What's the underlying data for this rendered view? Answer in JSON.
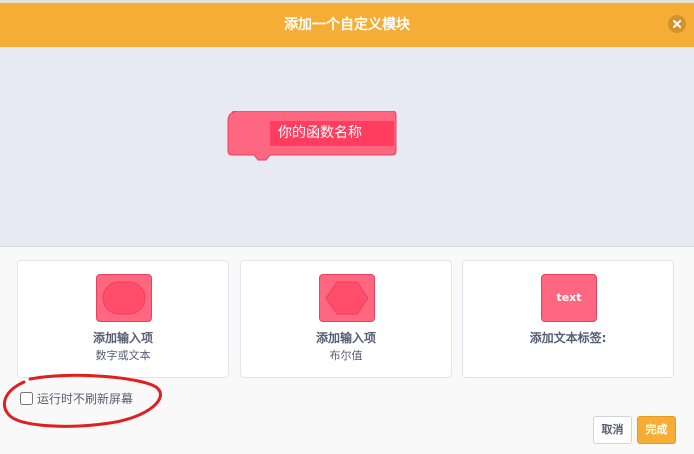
{
  "dialog": {
    "title": "添加一个自定义模块",
    "close_icon": "close-icon"
  },
  "preview": {
    "block_label": "你的函数名称"
  },
  "options": [
    {
      "title": "添加输入项",
      "subtitle": "数字或文本",
      "icon": "round-input-icon"
    },
    {
      "title": "添加输入项",
      "subtitle": "布尔值",
      "icon": "hexagon-input-icon"
    },
    {
      "title": "添加文本标签:",
      "icon_text": "text",
      "icon": "text-label-icon"
    }
  ],
  "refresh": {
    "label": "运行时不刷新屏幕",
    "checked": false
  },
  "buttons": {
    "cancel": "取消",
    "done": "完成"
  },
  "colors": {
    "header": "#f6ad35",
    "block": "#ff6680",
    "block_label_bg": "#ff3d5f",
    "preview_bg": "#e7eaf3",
    "annotation": "#e02020"
  }
}
